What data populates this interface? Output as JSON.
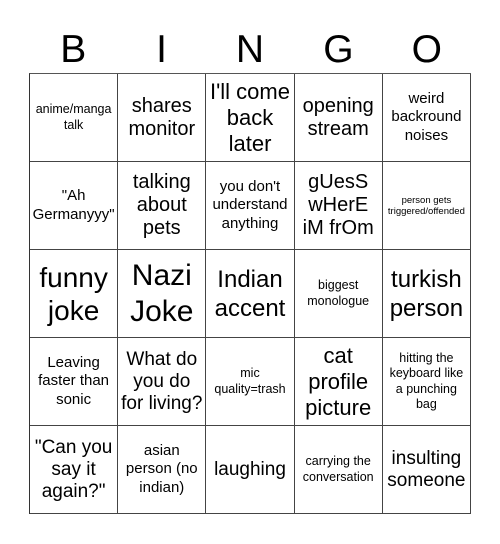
{
  "header": {
    "letters": [
      "B",
      "I",
      "N",
      "G",
      "O"
    ]
  },
  "grid": {
    "rows": [
      [
        "anime/manga talk",
        "shares monitor",
        "I'll come back later",
        "opening stream",
        "weird backround noises"
      ],
      [
        "\"Ah Germanyyy\"",
        "talking about pets",
        "you don't understand anything",
        "gUesS wHerE iM frOm",
        "person gets triggered/offended"
      ],
      [
        "funny joke",
        "Nazi Joke",
        "Indian accent",
        "biggest monologue",
        "turkish person"
      ],
      [
        "Leaving faster than sonic",
        "What do you do for living?",
        "mic quality=trash",
        "cat profile picture",
        "hitting the keyboard like a punching bag"
      ],
      [
        "\"Can you say it again?\"",
        "asian person (no indian)",
        "laughing",
        "carrying the conversation",
        "insulting someone"
      ]
    ]
  }
}
